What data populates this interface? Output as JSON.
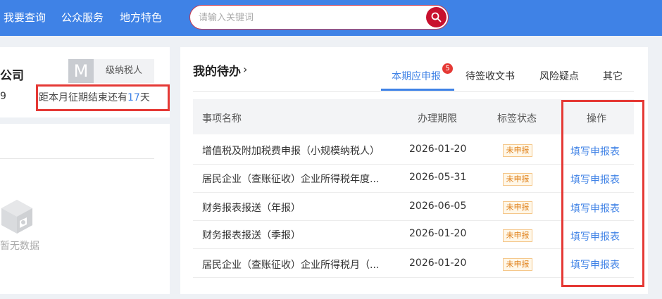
{
  "nav": {
    "items": [
      {
        "label": "我要查询"
      },
      {
        "label": "公众服务"
      },
      {
        "label": "地方特色"
      }
    ]
  },
  "search": {
    "placeholder": "请输入关键词",
    "value": ""
  },
  "profile": {
    "company_name_fragment": "公司",
    "avatar_letter": "M",
    "taxpayer_type": "级纳税人",
    "left_digit": "9",
    "deadline_prefix": "距本月征期结束还有",
    "deadline_days": "17",
    "deadline_suffix": "天"
  },
  "left_panel": {
    "empty_text": "暂无数据"
  },
  "todo": {
    "title": "我的待办",
    "chevron": "›",
    "tabs": [
      {
        "label": "本期应申报",
        "active": true,
        "badge": "5"
      },
      {
        "label": "待签收文书",
        "active": false
      },
      {
        "label": "风险疑点",
        "active": false
      },
      {
        "label": "其它",
        "active": false
      }
    ],
    "columns": [
      "事项名称",
      "办理期限",
      "标签状态",
      "操作"
    ],
    "rows": [
      {
        "name": "增值税及附加税费申报（小规模纳税人）",
        "deadline": "2026-01-20",
        "status": "未申报",
        "action": "填写申报表"
      },
      {
        "name": "居民企业（查账征收）企业所得税年度...",
        "deadline": "2026-05-31",
        "status": "未申报",
        "action": "填写申报表"
      },
      {
        "name": "财务报表报送（年报）",
        "deadline": "2026-06-05",
        "status": "未申报",
        "action": "填写申报表"
      },
      {
        "name": "财务报表报送（季报）",
        "deadline": "2026-01-20",
        "status": "未申报",
        "action": "填写申报表"
      },
      {
        "name": "居民企业（查账征收）企业所得税月（...",
        "deadline": "2026-01-20",
        "status": "未申报",
        "action": "填写申报表"
      }
    ]
  },
  "colors": {
    "topbar": "#3f82e6",
    "accent": "#3f82e6",
    "highlight_box": "#e53935",
    "status_tag": "#e0811a",
    "search_button": "#c8102e"
  }
}
